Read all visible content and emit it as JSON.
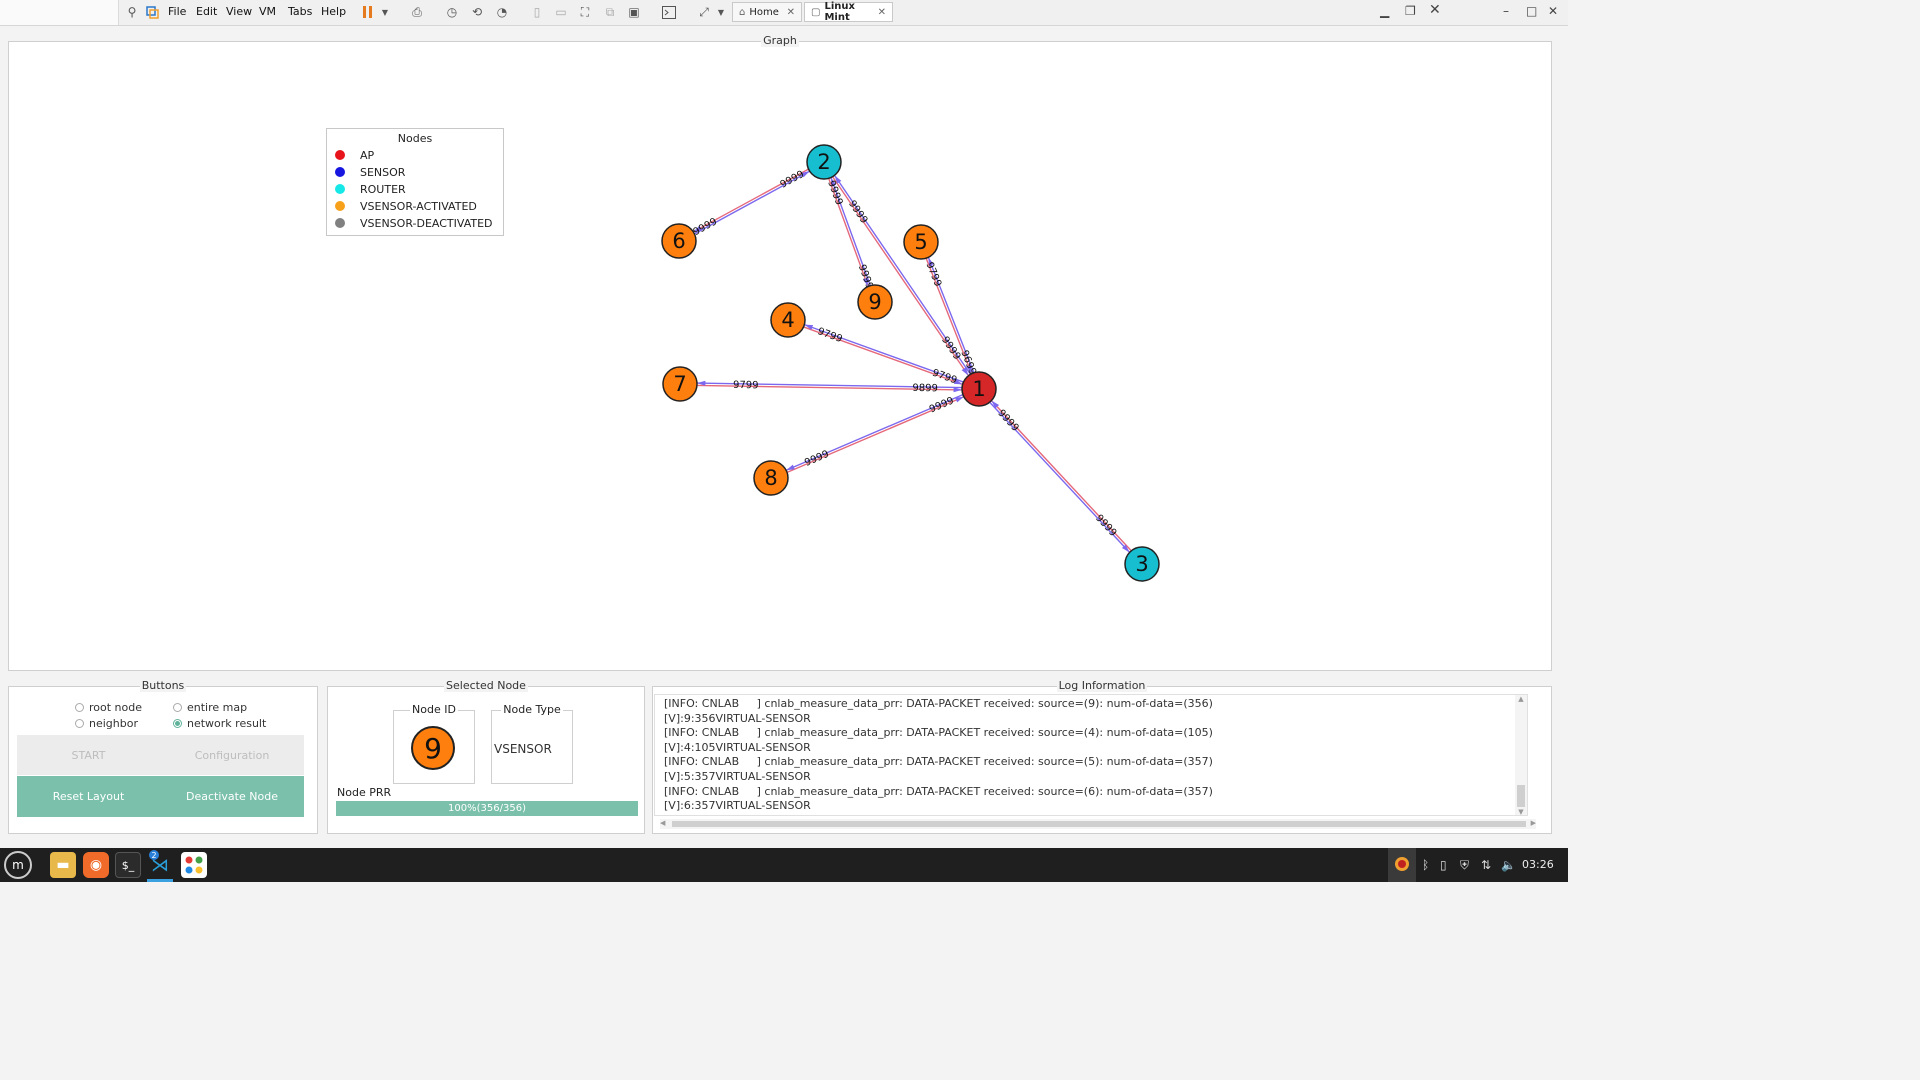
{
  "vm_toolbar": {
    "menu": [
      "File",
      "Edit",
      "View",
      "VM",
      "Tabs",
      "Help"
    ],
    "tabs": [
      {
        "label": "Home",
        "active": false
      },
      {
        "label": "Linux Mint",
        "active": true
      }
    ]
  },
  "graph": {
    "title": "Graph",
    "legend": {
      "title": "Nodes",
      "items": [
        {
          "label": "AP",
          "color": "#e8141c"
        },
        {
          "label": "SENSOR",
          "color": "#1616e0"
        },
        {
          "label": "ROUTER",
          "color": "#16e8e8"
        },
        {
          "label": "VSENSOR-ACTIVATED",
          "color": "#f7a11a"
        },
        {
          "label": "VSENSOR-DEACTIVATED",
          "color": "#808080"
        }
      ]
    },
    "nodes": [
      {
        "id": "1",
        "type": "AP",
        "color": "#d62728"
      },
      {
        "id": "2",
        "type": "ROUTER",
        "color": "#17becf"
      },
      {
        "id": "3",
        "type": "ROUTER",
        "color": "#17becf"
      },
      {
        "id": "4",
        "type": "VSENSOR-ACTIVATED",
        "color": "#ff7f0e"
      },
      {
        "id": "5",
        "type": "VSENSOR-ACTIVATED",
        "color": "#ff7f0e"
      },
      {
        "id": "6",
        "type": "VSENSOR-ACTIVATED",
        "color": "#ff7f0e"
      },
      {
        "id": "7",
        "type": "VSENSOR-ACTIVATED",
        "color": "#ff7f0e"
      },
      {
        "id": "8",
        "type": "VSENSOR-ACTIVATED",
        "color": "#ff7f0e"
      },
      {
        "id": "9",
        "type": "VSENSOR-ACTIVATED",
        "color": "#ff7f0e"
      }
    ],
    "edge_labels": {
      "e_2_6_a": "9999",
      "e_2_6_b": "9999",
      "e_2_9_a": "9999",
      "e_2_9_b": "9999",
      "e_2_1_a": "9999",
      "e_2_1_b": "9999",
      "e_5_1_a": "9799",
      "e_5_1_b": "9699",
      "e_4_1_a": "9799",
      "e_4_1_b": "9799",
      "e_7_1_a": "9799",
      "e_7_1_b": "9899",
      "e_8_1_a": "9999",
      "e_8_1_b": "9999",
      "e_3_1_a": "9999",
      "e_3_1_b": "9999"
    }
  },
  "buttons_panel": {
    "title": "Buttons",
    "radios": {
      "root_node": "root node",
      "entire_map": "entire map",
      "neighbor": "neighbor",
      "network_result": "network result",
      "selected": "network result"
    },
    "start": "START",
    "configuration": "Configuration",
    "reset_layout": "Reset Layout",
    "deactivate_node": "Deactivate Node"
  },
  "selected_node": {
    "title": "Selected Node",
    "node_id_label": "Node ID",
    "node_id": "9",
    "node_type_label": "Node Type",
    "node_type": "VSENSOR",
    "prr_label": "Node PRR",
    "prr_text": "100%(356/356)",
    "prr_fraction": 1.0
  },
  "log": {
    "title": "Log Information",
    "lines": [
      "[INFO: CNLAB     ] cnlab_measure_data_prr: DATA-PACKET received: source=(9): num-of-data=(356)",
      "[V]:9:356VIRTUAL-SENSOR",
      "[INFO: CNLAB     ] cnlab_measure_data_prr: DATA-PACKET received: source=(4): num-of-data=(105)",
      "[V]:4:105VIRTUAL-SENSOR",
      "[INFO: CNLAB     ] cnlab_measure_data_prr: DATA-PACKET received: source=(5): num-of-data=(357)",
      "[V]:5:357VIRTUAL-SENSOR",
      "[INFO: CNLAB     ] cnlab_measure_data_prr: DATA-PACKET received: source=(6): num-of-data=(357)",
      "[V]:6:357VIRTUAL-SENSOR"
    ]
  },
  "taskbar": {
    "clock": "03:26",
    "vscode_badge": "2"
  }
}
